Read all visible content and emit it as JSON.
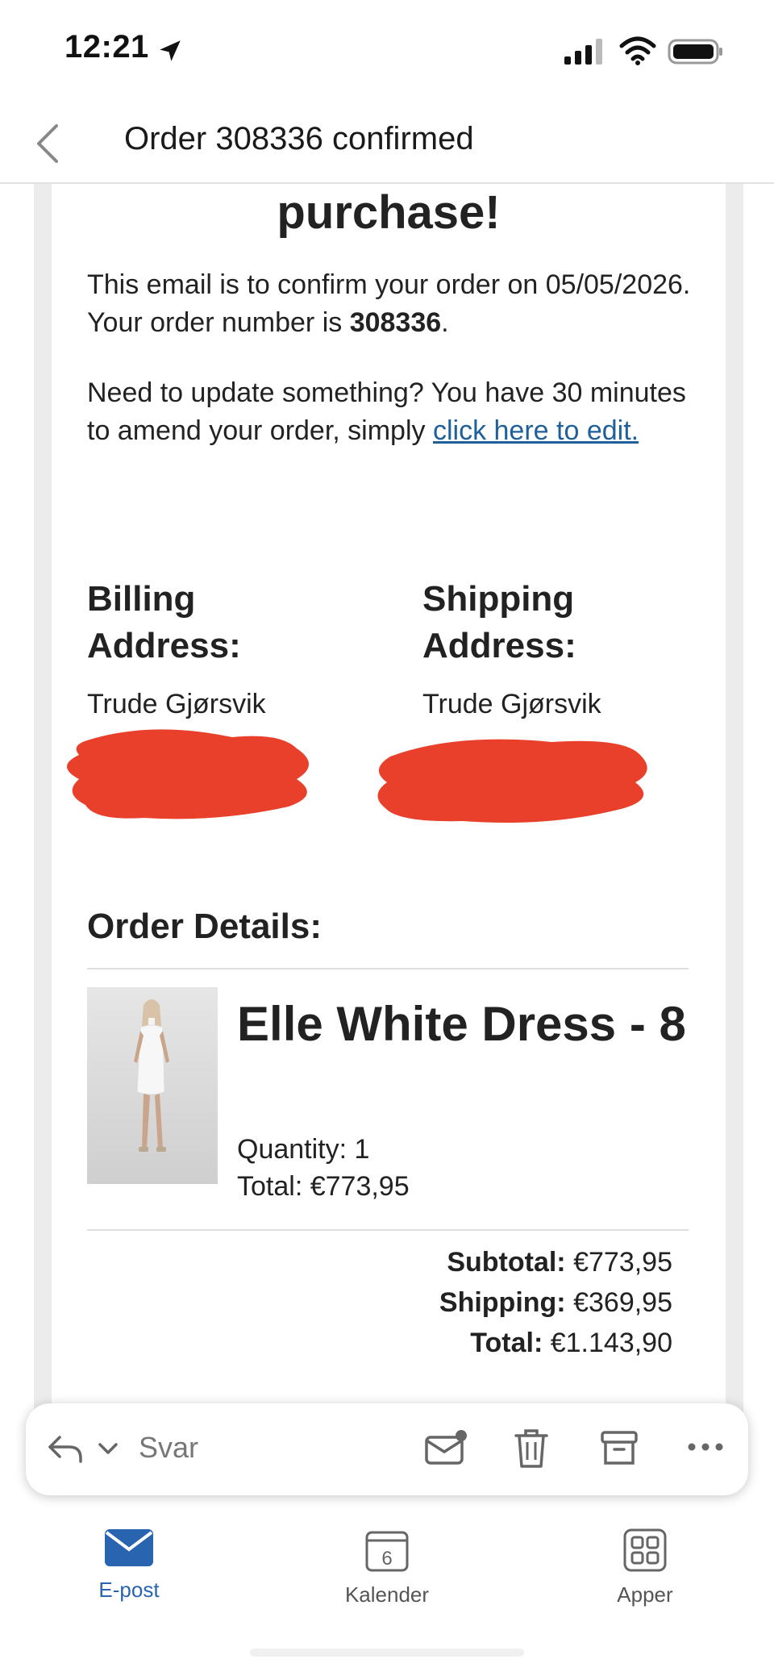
{
  "status_bar": {
    "time": "12:21"
  },
  "header": {
    "title": "Order 308336 confirmed"
  },
  "email": {
    "heading": "purchase!",
    "confirm_prefix": "This email is to confirm your order on 05/05/2026. Your order number is ",
    "order_number": "308336",
    "confirm_suffix": ".",
    "update_text": "Need to update something? You have 30 minutes to amend your order, simply ",
    "edit_link": "click here to edit.",
    "billing": {
      "heading": "Billing Address:",
      "name": "Trude Gjørsvik"
    },
    "shipping": {
      "heading": "Shipping Address:",
      "name": "Trude Gjørsvik"
    },
    "order_details_heading": "Order Details:",
    "item": {
      "name": "Elle White Dress - 8",
      "quantity": "Quantity: 1",
      "total": "Total: €773,95"
    },
    "summary": {
      "subtotal_label": "Subtotal:",
      "subtotal_value": "€773,95",
      "shipping_label": "Shipping:",
      "shipping_value": "€369,95",
      "total_label": "Total:",
      "total_value": "€1.143,90"
    }
  },
  "action_bar": {
    "reply_label": "Svar"
  },
  "tabs": [
    {
      "label": "E-post",
      "icon": "mail-icon",
      "active": true
    },
    {
      "label": "Kalender",
      "icon": "calendar-icon",
      "badge": "6"
    },
    {
      "label": "Apper",
      "icon": "apps-icon"
    }
  ],
  "colors": {
    "accent": "#2864b0",
    "link": "#1f5f9a",
    "redaction": "#e8402a"
  }
}
